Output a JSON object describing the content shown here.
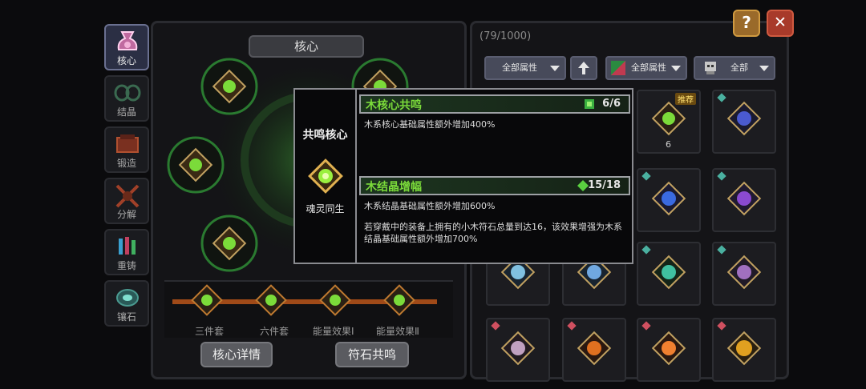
{
  "nav": {
    "items": [
      {
        "label": "核心",
        "icon": "core-icon",
        "active": true
      },
      {
        "label": "结晶",
        "icon": "crystal-icon",
        "active": false
      },
      {
        "label": "锻造",
        "icon": "forge-icon",
        "active": false
      },
      {
        "label": "分解",
        "icon": "decompose-icon",
        "active": false
      },
      {
        "label": "重铸",
        "icon": "recast-icon",
        "active": false
      },
      {
        "label": "镶石",
        "icon": "inlay-icon",
        "active": false
      }
    ]
  },
  "core_panel": {
    "tab_label": "核心",
    "sets": [
      "三件套",
      "六件套",
      "能量效果Ⅰ",
      "能量效果Ⅱ"
    ],
    "detail_button": "核心详情",
    "rune_button": "符石共鸣"
  },
  "inventory": {
    "count": "(79/1000)",
    "filter_attr": "全部属性",
    "filter_element": "全部属性",
    "filter_all": "全部",
    "recommend_badge": "推荐",
    "slot_counts": [
      "6",
      "6"
    ]
  },
  "top_buttons": {
    "help": "?",
    "close": "✕"
  },
  "tooltip": {
    "title": "共鸣核心",
    "core_name": "魂灵同生",
    "effect1": {
      "name": "木核心共鸣",
      "count": "6/6",
      "desc": "木系核心基础属性额外增加400%"
    },
    "effect2": {
      "name": "木结晶增幅",
      "count": "15/18",
      "desc": "木系结晶基础属性额外增加600%",
      "extra": "若穿戴中的装备上拥有的小木符石总量到达16，该效果增强为木系结晶基础属性额外增加700%"
    }
  },
  "colors": {
    "accent_green": "#7bdb3a",
    "panel_bg": "#141417",
    "close_red": "#b33a2a",
    "help_orange": "#c07a28"
  }
}
